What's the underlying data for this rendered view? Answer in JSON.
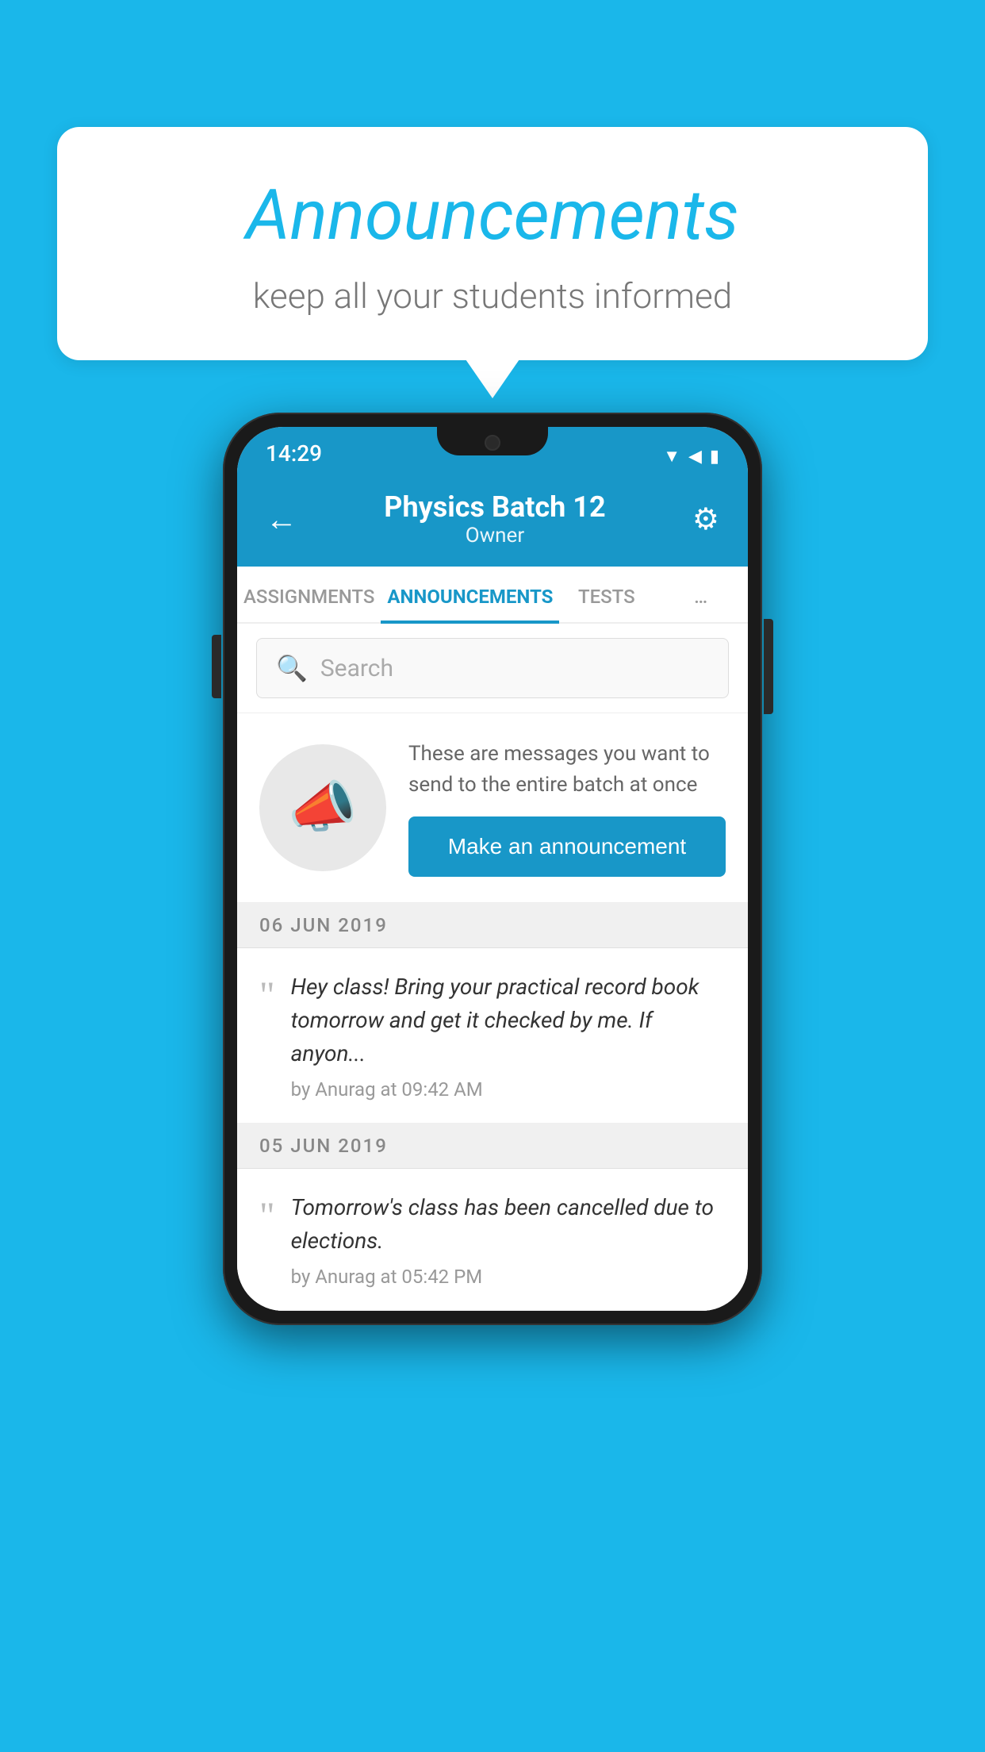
{
  "bubble": {
    "title": "Announcements",
    "subtitle": "keep all your students informed"
  },
  "phone": {
    "status": {
      "time": "14:29",
      "icons": [
        "▼",
        "◀",
        "▮"
      ]
    },
    "header": {
      "title": "Physics Batch 12",
      "subtitle": "Owner",
      "back_label": "←",
      "gear_label": "⚙"
    },
    "tabs": [
      {
        "label": "ASSIGNMENTS",
        "active": false
      },
      {
        "label": "ANNOUNCEMENTS",
        "active": true
      },
      {
        "label": "TESTS",
        "active": false
      },
      {
        "label": "…",
        "active": false
      }
    ],
    "search": {
      "placeholder": "Search"
    },
    "promo": {
      "description": "These are messages you want to send to the entire batch at once",
      "button_label": "Make an announcement"
    },
    "announcements": [
      {
        "date": "06  JUN  2019",
        "text": "Hey class! Bring your practical record book tomorrow and get it checked by me. If anyon...",
        "meta": "by Anurag at 09:42 AM"
      },
      {
        "date": "05  JUN  2019",
        "text": "Tomorrow's class has been cancelled due to elections.",
        "meta": "by Anurag at 05:42 PM"
      }
    ]
  }
}
